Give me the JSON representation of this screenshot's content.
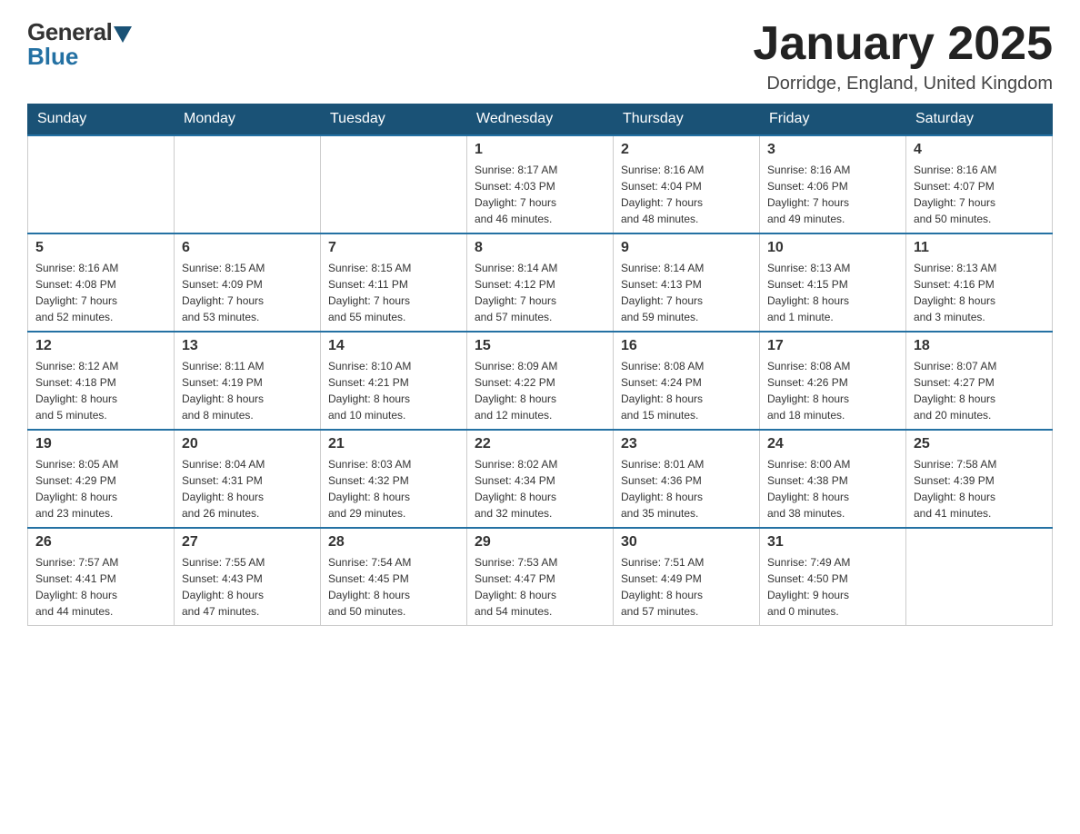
{
  "header": {
    "logo_general": "General",
    "logo_blue": "Blue",
    "month_title": "January 2025",
    "location": "Dorridge, England, United Kingdom"
  },
  "weekdays": [
    "Sunday",
    "Monday",
    "Tuesday",
    "Wednesday",
    "Thursday",
    "Friday",
    "Saturday"
  ],
  "weeks": [
    [
      {
        "day": "",
        "info": ""
      },
      {
        "day": "",
        "info": ""
      },
      {
        "day": "",
        "info": ""
      },
      {
        "day": "1",
        "info": "Sunrise: 8:17 AM\nSunset: 4:03 PM\nDaylight: 7 hours\nand 46 minutes."
      },
      {
        "day": "2",
        "info": "Sunrise: 8:16 AM\nSunset: 4:04 PM\nDaylight: 7 hours\nand 48 minutes."
      },
      {
        "day": "3",
        "info": "Sunrise: 8:16 AM\nSunset: 4:06 PM\nDaylight: 7 hours\nand 49 minutes."
      },
      {
        "day": "4",
        "info": "Sunrise: 8:16 AM\nSunset: 4:07 PM\nDaylight: 7 hours\nand 50 minutes."
      }
    ],
    [
      {
        "day": "5",
        "info": "Sunrise: 8:16 AM\nSunset: 4:08 PM\nDaylight: 7 hours\nand 52 minutes."
      },
      {
        "day": "6",
        "info": "Sunrise: 8:15 AM\nSunset: 4:09 PM\nDaylight: 7 hours\nand 53 minutes."
      },
      {
        "day": "7",
        "info": "Sunrise: 8:15 AM\nSunset: 4:11 PM\nDaylight: 7 hours\nand 55 minutes."
      },
      {
        "day": "8",
        "info": "Sunrise: 8:14 AM\nSunset: 4:12 PM\nDaylight: 7 hours\nand 57 minutes."
      },
      {
        "day": "9",
        "info": "Sunrise: 8:14 AM\nSunset: 4:13 PM\nDaylight: 7 hours\nand 59 minutes."
      },
      {
        "day": "10",
        "info": "Sunrise: 8:13 AM\nSunset: 4:15 PM\nDaylight: 8 hours\nand 1 minute."
      },
      {
        "day": "11",
        "info": "Sunrise: 8:13 AM\nSunset: 4:16 PM\nDaylight: 8 hours\nand 3 minutes."
      }
    ],
    [
      {
        "day": "12",
        "info": "Sunrise: 8:12 AM\nSunset: 4:18 PM\nDaylight: 8 hours\nand 5 minutes."
      },
      {
        "day": "13",
        "info": "Sunrise: 8:11 AM\nSunset: 4:19 PM\nDaylight: 8 hours\nand 8 minutes."
      },
      {
        "day": "14",
        "info": "Sunrise: 8:10 AM\nSunset: 4:21 PM\nDaylight: 8 hours\nand 10 minutes."
      },
      {
        "day": "15",
        "info": "Sunrise: 8:09 AM\nSunset: 4:22 PM\nDaylight: 8 hours\nand 12 minutes."
      },
      {
        "day": "16",
        "info": "Sunrise: 8:08 AM\nSunset: 4:24 PM\nDaylight: 8 hours\nand 15 minutes."
      },
      {
        "day": "17",
        "info": "Sunrise: 8:08 AM\nSunset: 4:26 PM\nDaylight: 8 hours\nand 18 minutes."
      },
      {
        "day": "18",
        "info": "Sunrise: 8:07 AM\nSunset: 4:27 PM\nDaylight: 8 hours\nand 20 minutes."
      }
    ],
    [
      {
        "day": "19",
        "info": "Sunrise: 8:05 AM\nSunset: 4:29 PM\nDaylight: 8 hours\nand 23 minutes."
      },
      {
        "day": "20",
        "info": "Sunrise: 8:04 AM\nSunset: 4:31 PM\nDaylight: 8 hours\nand 26 minutes."
      },
      {
        "day": "21",
        "info": "Sunrise: 8:03 AM\nSunset: 4:32 PM\nDaylight: 8 hours\nand 29 minutes."
      },
      {
        "day": "22",
        "info": "Sunrise: 8:02 AM\nSunset: 4:34 PM\nDaylight: 8 hours\nand 32 minutes."
      },
      {
        "day": "23",
        "info": "Sunrise: 8:01 AM\nSunset: 4:36 PM\nDaylight: 8 hours\nand 35 minutes."
      },
      {
        "day": "24",
        "info": "Sunrise: 8:00 AM\nSunset: 4:38 PM\nDaylight: 8 hours\nand 38 minutes."
      },
      {
        "day": "25",
        "info": "Sunrise: 7:58 AM\nSunset: 4:39 PM\nDaylight: 8 hours\nand 41 minutes."
      }
    ],
    [
      {
        "day": "26",
        "info": "Sunrise: 7:57 AM\nSunset: 4:41 PM\nDaylight: 8 hours\nand 44 minutes."
      },
      {
        "day": "27",
        "info": "Sunrise: 7:55 AM\nSunset: 4:43 PM\nDaylight: 8 hours\nand 47 minutes."
      },
      {
        "day": "28",
        "info": "Sunrise: 7:54 AM\nSunset: 4:45 PM\nDaylight: 8 hours\nand 50 minutes."
      },
      {
        "day": "29",
        "info": "Sunrise: 7:53 AM\nSunset: 4:47 PM\nDaylight: 8 hours\nand 54 minutes."
      },
      {
        "day": "30",
        "info": "Sunrise: 7:51 AM\nSunset: 4:49 PM\nDaylight: 8 hours\nand 57 minutes."
      },
      {
        "day": "31",
        "info": "Sunrise: 7:49 AM\nSunset: 4:50 PM\nDaylight: 9 hours\nand 0 minutes."
      },
      {
        "day": "",
        "info": ""
      }
    ]
  ]
}
